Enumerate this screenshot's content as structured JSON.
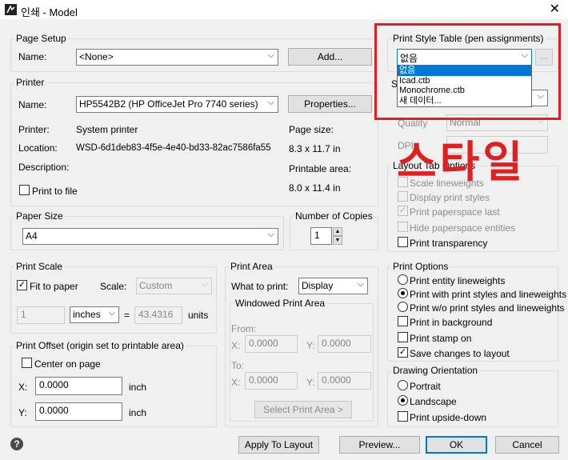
{
  "window": {
    "title": "인쇄 - Model",
    "close": "✕"
  },
  "page_setup": {
    "legend": "Page Setup",
    "name_label": "Name:",
    "name_value": "<None>",
    "add_button": "Add..."
  },
  "printer": {
    "legend": "Printer",
    "name_label": "Name:",
    "name_value": "HP5542B2 (HP OfficeJet Pro 7740 series)",
    "properties_button": "Properties...",
    "printer_label": "Printer:",
    "printer_value": "System printer",
    "location_label": "Location:",
    "location_value": "WSD-6d1deb83-4f5e-4e40-bd33-82ac7586fa55",
    "description_label": "Description:",
    "page_size_label": "Page size:",
    "page_size_value": "8.3 x 11.7 in",
    "printable_area_label": "Printable area:",
    "printable_area_value": "8.0 x 11.4 in",
    "print_to_file": "Print to file"
  },
  "paper_size": {
    "legend": "Paper Size",
    "value": "A4"
  },
  "copies": {
    "legend": "Number of Copies",
    "value": "1"
  },
  "print_scale": {
    "legend": "Print Scale",
    "fit_to_paper": "Fit to paper",
    "scale_label": "Scale:",
    "scale_value": "Custom",
    "num_value": "1",
    "unit_value": "inches",
    "equals": "=",
    "units_value": "43.4316",
    "units_label": "units"
  },
  "print_area": {
    "legend": "Print Area",
    "what_label": "What to print:",
    "what_value": "Display",
    "windowed_legend": "Windowed Print Area",
    "from_label": "From:",
    "to_label": "To:",
    "x_label": "X:",
    "y_label": "Y:",
    "from_x": "0.0000",
    "from_y": "0.0000",
    "to_x": "0.0000",
    "to_y": "0.0000",
    "select_button": "Select Print Area >"
  },
  "print_offset": {
    "legend": "Print Offset (origin set to printable area)",
    "center_on_page": "Center on page",
    "x_label": "X:",
    "y_label": "Y:",
    "x_value": "0.0000",
    "y_value": "0.0000",
    "x_unit": "inch",
    "y_unit": "inch"
  },
  "print_style": {
    "legend": "Print Style Table (pen assignments)",
    "value": "없음",
    "more": "...",
    "options": [
      "없음",
      "Icad.ctb",
      "Monochrome.ctb",
      "새 데이터..."
    ]
  },
  "shaded": {
    "partial_label": "S",
    "quality_label": "Quality",
    "quality_value": "Normal",
    "dpi_label": "DPI"
  },
  "annotation": {
    "text": "스타일"
  },
  "layout_tab": {
    "legend": "Layout Tab Options",
    "scale_lineweights": "Scale lineweights",
    "display_print_styles": "Display print styles",
    "print_paperspace_last": "Print paperspace last",
    "hide_paperspace_entities": "Hide paperspace entities",
    "print_transparency": "Print transparency"
  },
  "print_options": {
    "legend": "Print Options",
    "opt1": "Print entity lineweights",
    "opt2": "Print with print styles and lineweights",
    "opt3": "Print w/o print styles and lineweights",
    "background": "Print in background",
    "stamp": "Print stamp on",
    "save_changes": "Save changes to layout"
  },
  "orientation": {
    "legend": "Drawing Orientation",
    "portrait": "Portrait",
    "landscape": "Landscape",
    "upside_down": "Print upside-down"
  },
  "buttons": {
    "help": "?",
    "apply": "Apply To Layout",
    "preview": "Preview...",
    "ok": "OK",
    "cancel": "Cancel"
  },
  "colors": {
    "annotation": "#e02020",
    "selection": "#0078d7"
  }
}
